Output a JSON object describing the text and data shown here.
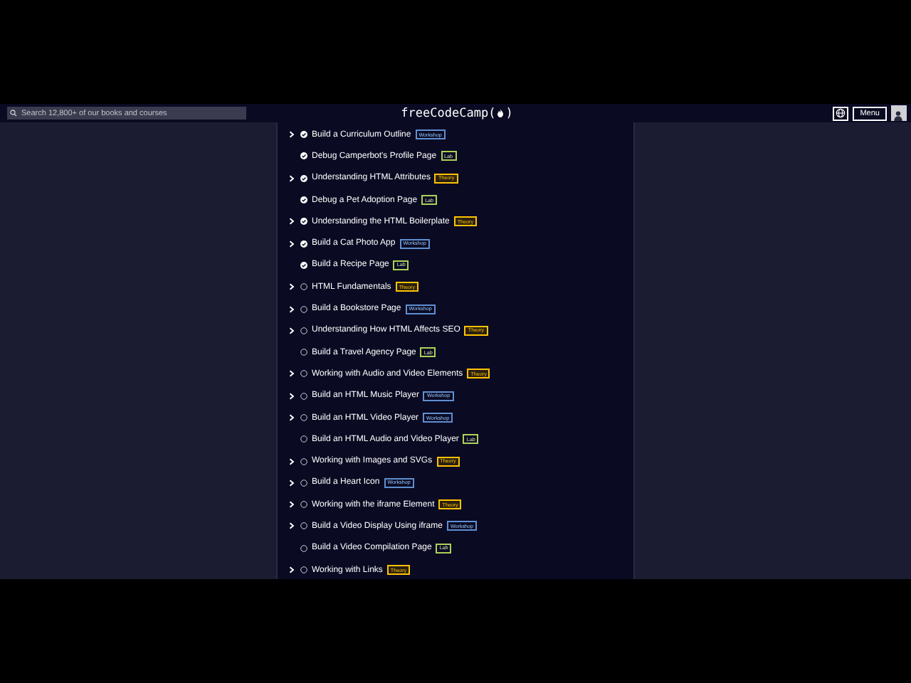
{
  "navbar": {
    "search": {
      "placeholder": "Search 12,800+ of our books and courses"
    },
    "logo": {
      "text": "freeCodeCamp",
      "open": "(",
      "close": ")"
    },
    "menu_button": "Menu"
  },
  "blocks": [
    {
      "title": "Build a Curriculum Outline",
      "tag": "Workshop",
      "kind": "workshop",
      "expandable": true,
      "completed": true
    },
    {
      "title": "Debug Camperbot's Profile Page",
      "tag": "Lab",
      "kind": "lab",
      "expandable": false,
      "completed": true
    },
    {
      "title": "Understanding HTML Attributes",
      "tag": "Theory",
      "kind": "theory",
      "expandable": true,
      "completed": true
    },
    {
      "title": "Debug a Pet Adoption Page",
      "tag": "Lab",
      "kind": "lab",
      "expandable": false,
      "completed": true
    },
    {
      "title": "Understanding the HTML Boilerplate",
      "tag": "Theory",
      "kind": "theory",
      "expandable": true,
      "completed": true
    },
    {
      "title": "Build a Cat Photo App",
      "tag": "Workshop",
      "kind": "workshop",
      "expandable": true,
      "completed": true
    },
    {
      "title": "Build a Recipe Page",
      "tag": "Lab",
      "kind": "lab",
      "expandable": false,
      "completed": true
    },
    {
      "title": "HTML Fundamentals",
      "tag": "Theory",
      "kind": "theory",
      "expandable": true,
      "completed": false
    },
    {
      "title": "Build a Bookstore Page",
      "tag": "Workshop",
      "kind": "workshop",
      "expandable": true,
      "completed": false
    },
    {
      "title": "Understanding How HTML Affects SEO",
      "tag": "Theory",
      "kind": "theory",
      "expandable": true,
      "completed": false
    },
    {
      "title": "Build a Travel Agency Page",
      "tag": "Lab",
      "kind": "lab",
      "expandable": false,
      "completed": false
    },
    {
      "title": "Working with Audio and Video Elements",
      "tag": "Theory",
      "kind": "theory",
      "expandable": true,
      "completed": false
    },
    {
      "title": "Build an HTML Music Player",
      "tag": "Workshop",
      "kind": "workshop",
      "expandable": true,
      "completed": false
    },
    {
      "title": "Build an HTML Video Player",
      "tag": "Workshop",
      "kind": "workshop",
      "expandable": true,
      "completed": false
    },
    {
      "title": "Build an HTML Audio and Video Player",
      "tag": "Lab",
      "kind": "lab",
      "expandable": false,
      "completed": false
    },
    {
      "title": "Working with Images and SVGs",
      "tag": "Theory",
      "kind": "theory",
      "expandable": true,
      "completed": false
    },
    {
      "title": "Build a Heart Icon",
      "tag": "Workshop",
      "kind": "workshop",
      "expandable": true,
      "completed": false
    },
    {
      "title": "Working with the iframe Element",
      "tag": "Theory",
      "kind": "theory",
      "expandable": true,
      "completed": false
    },
    {
      "title": "Build a Video Display Using iframe",
      "tag": "Workshop",
      "kind": "workshop",
      "expandable": true,
      "completed": false
    },
    {
      "title": "Build a Video Compilation Page",
      "tag": "Lab",
      "kind": "lab",
      "expandable": false,
      "completed": false
    },
    {
      "title": "Working with Links",
      "tag": "Theory",
      "kind": "theory",
      "expandable": true,
      "completed": false
    }
  ]
}
